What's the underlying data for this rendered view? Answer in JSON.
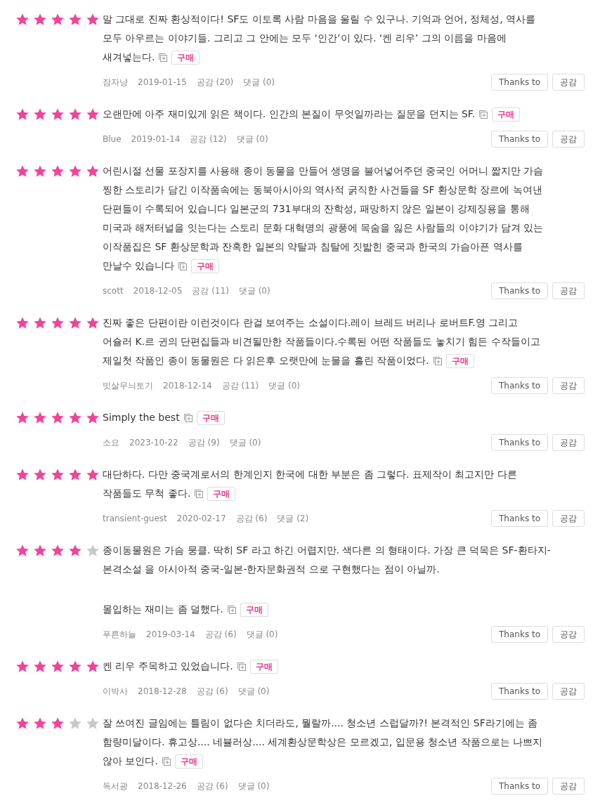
{
  "reviews": [
    {
      "stars": 5,
      "paragraphs": [
        [
          "말 그대로 진짜 환상적이다! SF도 이토록 사람 마음을 울릴 수 있구나. 기억과 언어, 정체성, 역사를",
          "모두 아우르는 이야기들. 그리고 그 안에는 모두 ‘인간’이 있다. ‘켄 리우’ 그의 이름을 마음에",
          "새겨넣는다."
        ]
      ],
      "badge": "구매",
      "author": "잠자냥",
      "date": "2019-01-15",
      "likes": "공감 (20)",
      "comments": "댓글 (0)",
      "thanks_button": "Thanks to",
      "like_button": "공감"
    },
    {
      "stars": 5,
      "paragraphs": [
        [
          "오랜만에 아주 재미있게 읽은 책이다. 인간의 본질이 무엇일까라는 질문을 던지는 SF."
        ]
      ],
      "badge": "구매",
      "author": "Blue",
      "date": "2019-01-14",
      "likes": "공감 (12)",
      "comments": "댓글 (0)",
      "thanks_button": "Thanks to",
      "like_button": "공감"
    },
    {
      "stars": 5,
      "paragraphs": [
        [
          "어린시절 선물 포장지를 사용해 종이 동물을 만들어 생명을 불어넣어주던 중국인 어머니 짧지만 가슴",
          "찡한 스토리가 담긴 이작품속에는 동북아시아의 역사적 굵직한 사건들을 SF 환상문학 장르에 녹여낸",
          "단편들이 수록되어 있습니다 일본군의 731부대의 잔학성, 패망하지 않은 일본이 강제징용을 통해",
          "미국과 해저터널을 잇는다는 스토리 문화 대혁명의 광풍에 목숨을 잃은 사람들의 이야기가 담겨 있는",
          "이작품집은 SF 환상문학과 잔혹한 일본의 약탈과 침탈에 짓밟힌 중국과 한국의 가슴아픈 역사를",
          "만날수 있습니다"
        ]
      ],
      "badge": "구매",
      "author": "scott",
      "date": "2018-12-05",
      "likes": "공감 (11)",
      "comments": "댓글 (0)",
      "thanks_button": "Thanks to",
      "like_button": "공감"
    },
    {
      "stars": 5,
      "paragraphs": [
        [
          "진짜 좋은 단편이란 이런것이다 란걸 보여주는 소설이다.레이 브레드 버리나 로버트F.영 그리고",
          "어슐러 K.르 귄의 단편집들과 비견될만한 작품들이다.수록된 어떤 작품들도 놓치기 힘든 수작들이고",
          "제일첫 작품인 종이 동물원은 다 읽은후 오랫만에 눈물을 흘린 작품이었다."
        ]
      ],
      "badge": "구매",
      "author": "빗살무늬토기",
      "date": "2018-12-14",
      "likes": "공감 (11)",
      "comments": "댓글 (0)",
      "thanks_button": "Thanks to",
      "like_button": "공감"
    },
    {
      "stars": 5,
      "paragraphs": [
        [
          "Simply the best"
        ]
      ],
      "badge": "구매",
      "author": "소요",
      "date": "2023-10-22",
      "likes": "공감 (9)",
      "comments": "댓글 (0)",
      "thanks_button": "Thanks to",
      "like_button": "공감"
    },
    {
      "stars": 5,
      "paragraphs": [
        [
          "대단하다. 다만 중국계로서의 한계인지 한국에 대한 부분은 좀 그렇다. 표제작이 최고지만 다른",
          "작품들도 무척 좋다."
        ]
      ],
      "badge": "구매",
      "author": "transient-guest",
      "date": "2020-02-17",
      "likes": "공감 (6)",
      "comments": "댓글 (2)",
      "thanks_button": "Thanks to",
      "like_button": "공감"
    },
    {
      "stars": 4,
      "paragraphs": [
        [
          "종이동물원은 가슴 뭉클. 딱히 SF 라고 하긴 어렵지만. 색다른 의 형태이다. 가장 큰 덕목은 SF-환타지-",
          "본격소설 을 아시아적 중국-일본-한자문화권적 으로 구현했다는 점이 아닐까."
        ],
        [
          "몰입하는 재미는 좀 덜했다."
        ]
      ],
      "badge": "구매",
      "author": "푸른하늘",
      "date": "2019-03-14",
      "likes": "공감 (6)",
      "comments": "댓글 (0)",
      "thanks_button": "Thanks to",
      "like_button": "공감"
    },
    {
      "stars": 5,
      "paragraphs": [
        [
          "켄 리우 주목하고 있었습니다."
        ]
      ],
      "badge": "구매",
      "author": "이박사",
      "date": "2018-12-28",
      "likes": "공감 (6)",
      "comments": "댓글 (0)",
      "thanks_button": "Thanks to",
      "like_button": "공감"
    },
    {
      "stars": 3,
      "paragraphs": [
        [
          "잘 쓰여진 글임에는 틀림이 없다손 치더라도, 뭘랄까.... 청소년 스럽달까?! 본격적인 SF라기에는 좀",
          "함량미달이다. 휴고상.... 네뷸러상.... 세계환상문학상은 모르겠고, 입문용 청소년 작품으로는 나쁘지",
          "않아 보인다."
        ]
      ],
      "badge": "구매",
      "author": "독서광",
      "date": "2018-12-26",
      "likes": "공감 (6)",
      "comments": "댓글 (0)",
      "thanks_button": "Thanks to",
      "like_button": "공감"
    }
  ]
}
